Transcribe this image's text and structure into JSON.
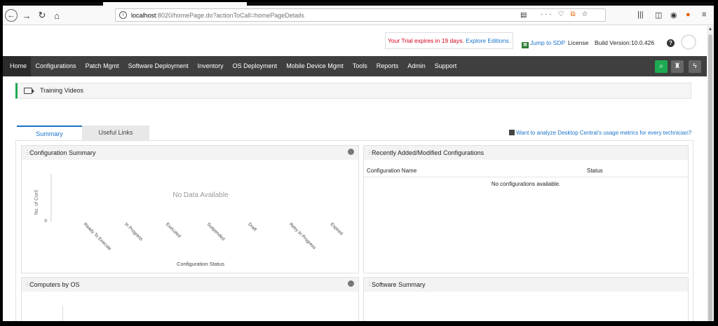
{
  "browser": {
    "url_host": "localhost",
    "url_rest": ":8020/homePage.do?actionToCall=homePageDetails",
    "page_actions": "···",
    "icons": [
      "back-icon",
      "forward-icon",
      "reload-icon",
      "home-icon",
      "info-icon",
      "reader-icon",
      "more-icon",
      "pocket-icon",
      "extension-icon",
      "bookmark-star-icon",
      "library-icon",
      "sidebar-icon",
      "addon-icon",
      "firefox-account-icon",
      "menu-icon"
    ]
  },
  "header": {
    "trial_text": "Your Trial expires in 19 days.",
    "trial_link": "Explore Editions.",
    "jump_sdp": "Jump to SDP",
    "license": "License",
    "build_version": "Build Version:10.0.426",
    "help": "?"
  },
  "nav": {
    "items": [
      "Home",
      "Configurations",
      "Patch Mgmt",
      "Software Deployment",
      "Inventory",
      "OS Deployment",
      "Mobile Device Mgmt",
      "Tools",
      "Reports",
      "Admin",
      "Support"
    ],
    "active": "Home"
  },
  "training": {
    "label": "Training Videos"
  },
  "tabs": {
    "summary": "Summary",
    "useful_links": "Useful Links",
    "active": "Summary"
  },
  "metrics_link": "Want to analyze Desktop Central's usage metrics for every technician?",
  "widgets": {
    "config_summary": {
      "title": "Configuration Summary"
    },
    "recent_configs": {
      "title": "Recently Added/Modified Configurations",
      "columns": [
        "Configuration Name",
        "Status"
      ],
      "empty": "No configurations available."
    },
    "computers_by_os": {
      "title": "Computers by OS"
    },
    "software_summary": {
      "title": "Software Summary"
    }
  },
  "chart_data": {
    "type": "bar",
    "title": "",
    "xlabel": "Configuration Status",
    "ylabel": "No. of Conf.",
    "categories": [
      "Ready To Execute",
      "In Progress",
      "Executed",
      "Suspended",
      "Draft",
      "Retry In Progress",
      "Expired"
    ],
    "values": [],
    "y_ticks": [
      "0"
    ],
    "no_data_text": "No Data Available"
  }
}
